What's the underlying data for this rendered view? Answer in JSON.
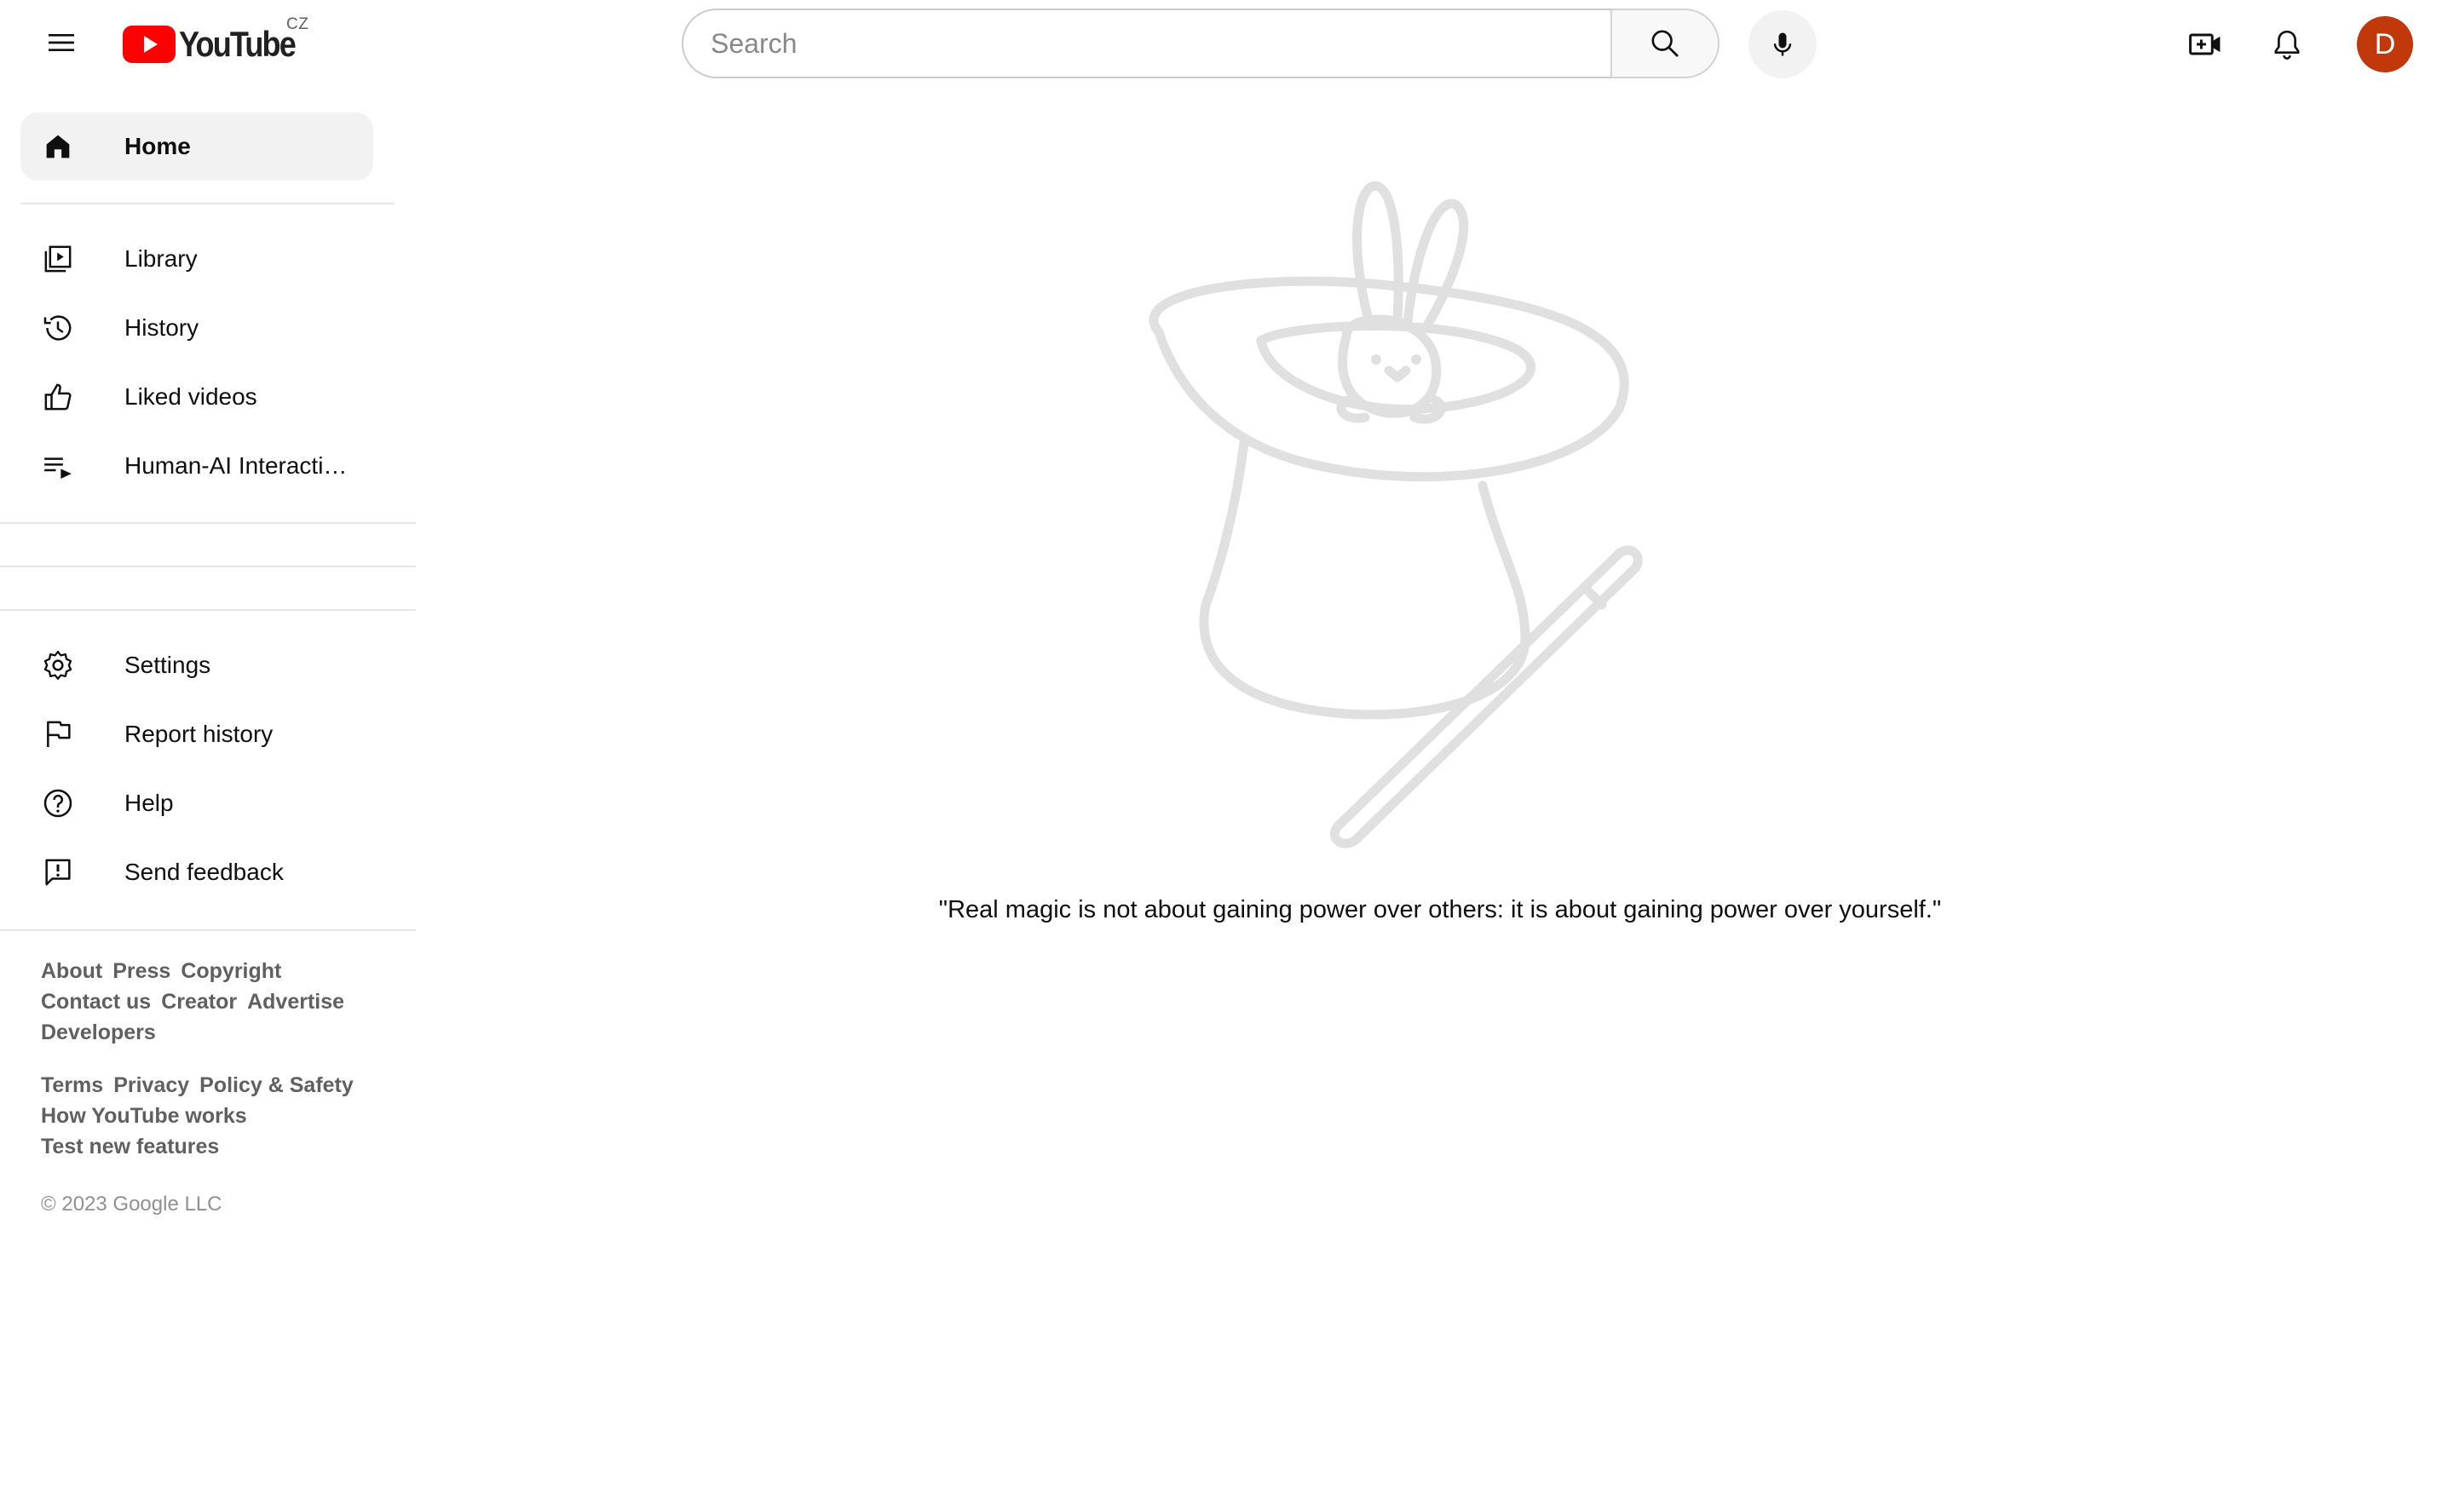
{
  "header": {
    "logo_text": "YouTube",
    "country_code": "CZ",
    "search_placeholder": "Search",
    "avatar_letter": "D",
    "brand_red": "#ff0000",
    "avatar_color": "#c1390b"
  },
  "sidebar": {
    "primary": [
      {
        "label": "Home",
        "icon": "home-icon",
        "active": true
      }
    ],
    "library": [
      {
        "label": "Library",
        "icon": "library-icon"
      },
      {
        "label": "History",
        "icon": "history-icon"
      },
      {
        "label": "Liked videos",
        "icon": "thumbs-up-icon"
      },
      {
        "label": "Human-AI Interacti…",
        "icon": "playlist-icon"
      }
    ],
    "settings": [
      {
        "label": "Settings",
        "icon": "gear-icon"
      },
      {
        "label": "Report history",
        "icon": "flag-icon"
      },
      {
        "label": "Help",
        "icon": "help-icon"
      },
      {
        "label": "Send feedback",
        "icon": "feedback-icon"
      }
    ],
    "footer": {
      "links_1": [
        "About",
        "Press",
        "Copyright"
      ],
      "links_2": [
        "Contact us",
        "Creator",
        "Advertise"
      ],
      "links_3": [
        "Developers"
      ],
      "links_4": [
        "Terms",
        "Privacy",
        "Policy & Safety"
      ],
      "links_5": [
        "How YouTube works"
      ],
      "links_6": [
        "Test new features"
      ],
      "copyright": "© 2023 Google LLC"
    }
  },
  "main": {
    "illustration": "magic-hat-rabbit-illustration",
    "quote": "\"Real magic is not about gaining power over others: it is about gaining power over yourself.\""
  }
}
